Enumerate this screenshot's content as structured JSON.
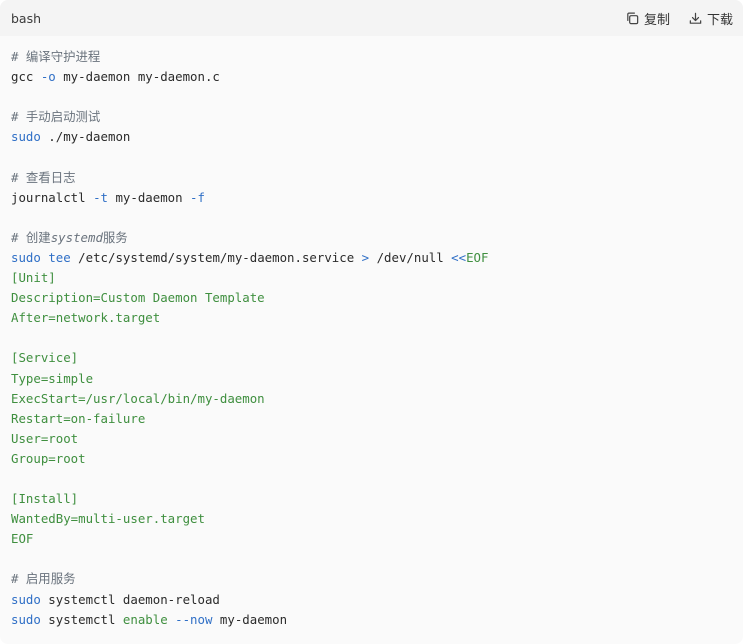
{
  "header": {
    "language": "bash",
    "copy_label": "复制",
    "download_label": "下载",
    "copy_icon": "copy-icon",
    "download_icon": "download-icon"
  },
  "colors": {
    "comment": "#6a737d",
    "keyword": "#2f6fc6",
    "string": "#3f8f3f",
    "plain": "#2b2b2b",
    "header_bg": "#f4f4f4",
    "body_bg": "#fafafa"
  },
  "code": {
    "lines": [
      [
        {
          "t": "comment",
          "v": "# 编译守护进程"
        }
      ],
      [
        {
          "t": "plain",
          "v": "gcc "
        },
        {
          "t": "kw",
          "v": "-o"
        },
        {
          "t": "plain",
          "v": " my-daemon my-daemon.c"
        }
      ],
      [],
      [
        {
          "t": "comment",
          "v": "# 手动启动测试"
        }
      ],
      [
        {
          "t": "kw",
          "v": "sudo"
        },
        {
          "t": "plain",
          "v": " ./my-daemon"
        }
      ],
      [],
      [
        {
          "t": "comment",
          "v": "# 查看日志"
        }
      ],
      [
        {
          "t": "plain",
          "v": "journalctl "
        },
        {
          "t": "kw",
          "v": "-t"
        },
        {
          "t": "plain",
          "v": " my-daemon "
        },
        {
          "t": "kw",
          "v": "-f"
        }
      ],
      [],
      [
        {
          "t": "comment",
          "v": "# 创建"
        },
        {
          "t": "comment-em",
          "v": "systemd"
        },
        {
          "t": "comment",
          "v": "服务"
        }
      ],
      [
        {
          "t": "kw",
          "v": "sudo"
        },
        {
          "t": "plain",
          "v": " "
        },
        {
          "t": "kw",
          "v": "tee"
        },
        {
          "t": "plain",
          "v": " /etc/systemd/system/my-daemon.service "
        },
        {
          "t": "op",
          "v": ">"
        },
        {
          "t": "plain",
          "v": " /dev/null "
        },
        {
          "t": "op",
          "v": "<<"
        },
        {
          "t": "str",
          "v": "EOF"
        }
      ],
      [
        {
          "t": "str",
          "v": "[Unit]"
        }
      ],
      [
        {
          "t": "str",
          "v": "Description=Custom Daemon Template"
        }
      ],
      [
        {
          "t": "str",
          "v": "After=network.target"
        }
      ],
      [],
      [
        {
          "t": "str",
          "v": "[Service]"
        }
      ],
      [
        {
          "t": "str",
          "v": "Type=simple"
        }
      ],
      [
        {
          "t": "str",
          "v": "ExecStart=/usr/local/bin/my-daemon"
        }
      ],
      [
        {
          "t": "str",
          "v": "Restart=on-failure"
        }
      ],
      [
        {
          "t": "str",
          "v": "User=root"
        }
      ],
      [
        {
          "t": "str",
          "v": "Group=root"
        }
      ],
      [],
      [
        {
          "t": "str",
          "v": "[Install]"
        }
      ],
      [
        {
          "t": "str",
          "v": "WantedBy=multi-user.target"
        }
      ],
      [
        {
          "t": "str",
          "v": "EOF"
        }
      ],
      [],
      [
        {
          "t": "comment",
          "v": "# 启用服务"
        }
      ],
      [
        {
          "t": "kw",
          "v": "sudo"
        },
        {
          "t": "plain",
          "v": " systemctl daemon-reload"
        }
      ],
      [
        {
          "t": "kw",
          "v": "sudo"
        },
        {
          "t": "plain",
          "v": " systemctl "
        },
        {
          "t": "str",
          "v": "enable"
        },
        {
          "t": "plain",
          "v": " "
        },
        {
          "t": "kw",
          "v": "--now"
        },
        {
          "t": "plain",
          "v": " my-daemon"
        }
      ]
    ]
  }
}
